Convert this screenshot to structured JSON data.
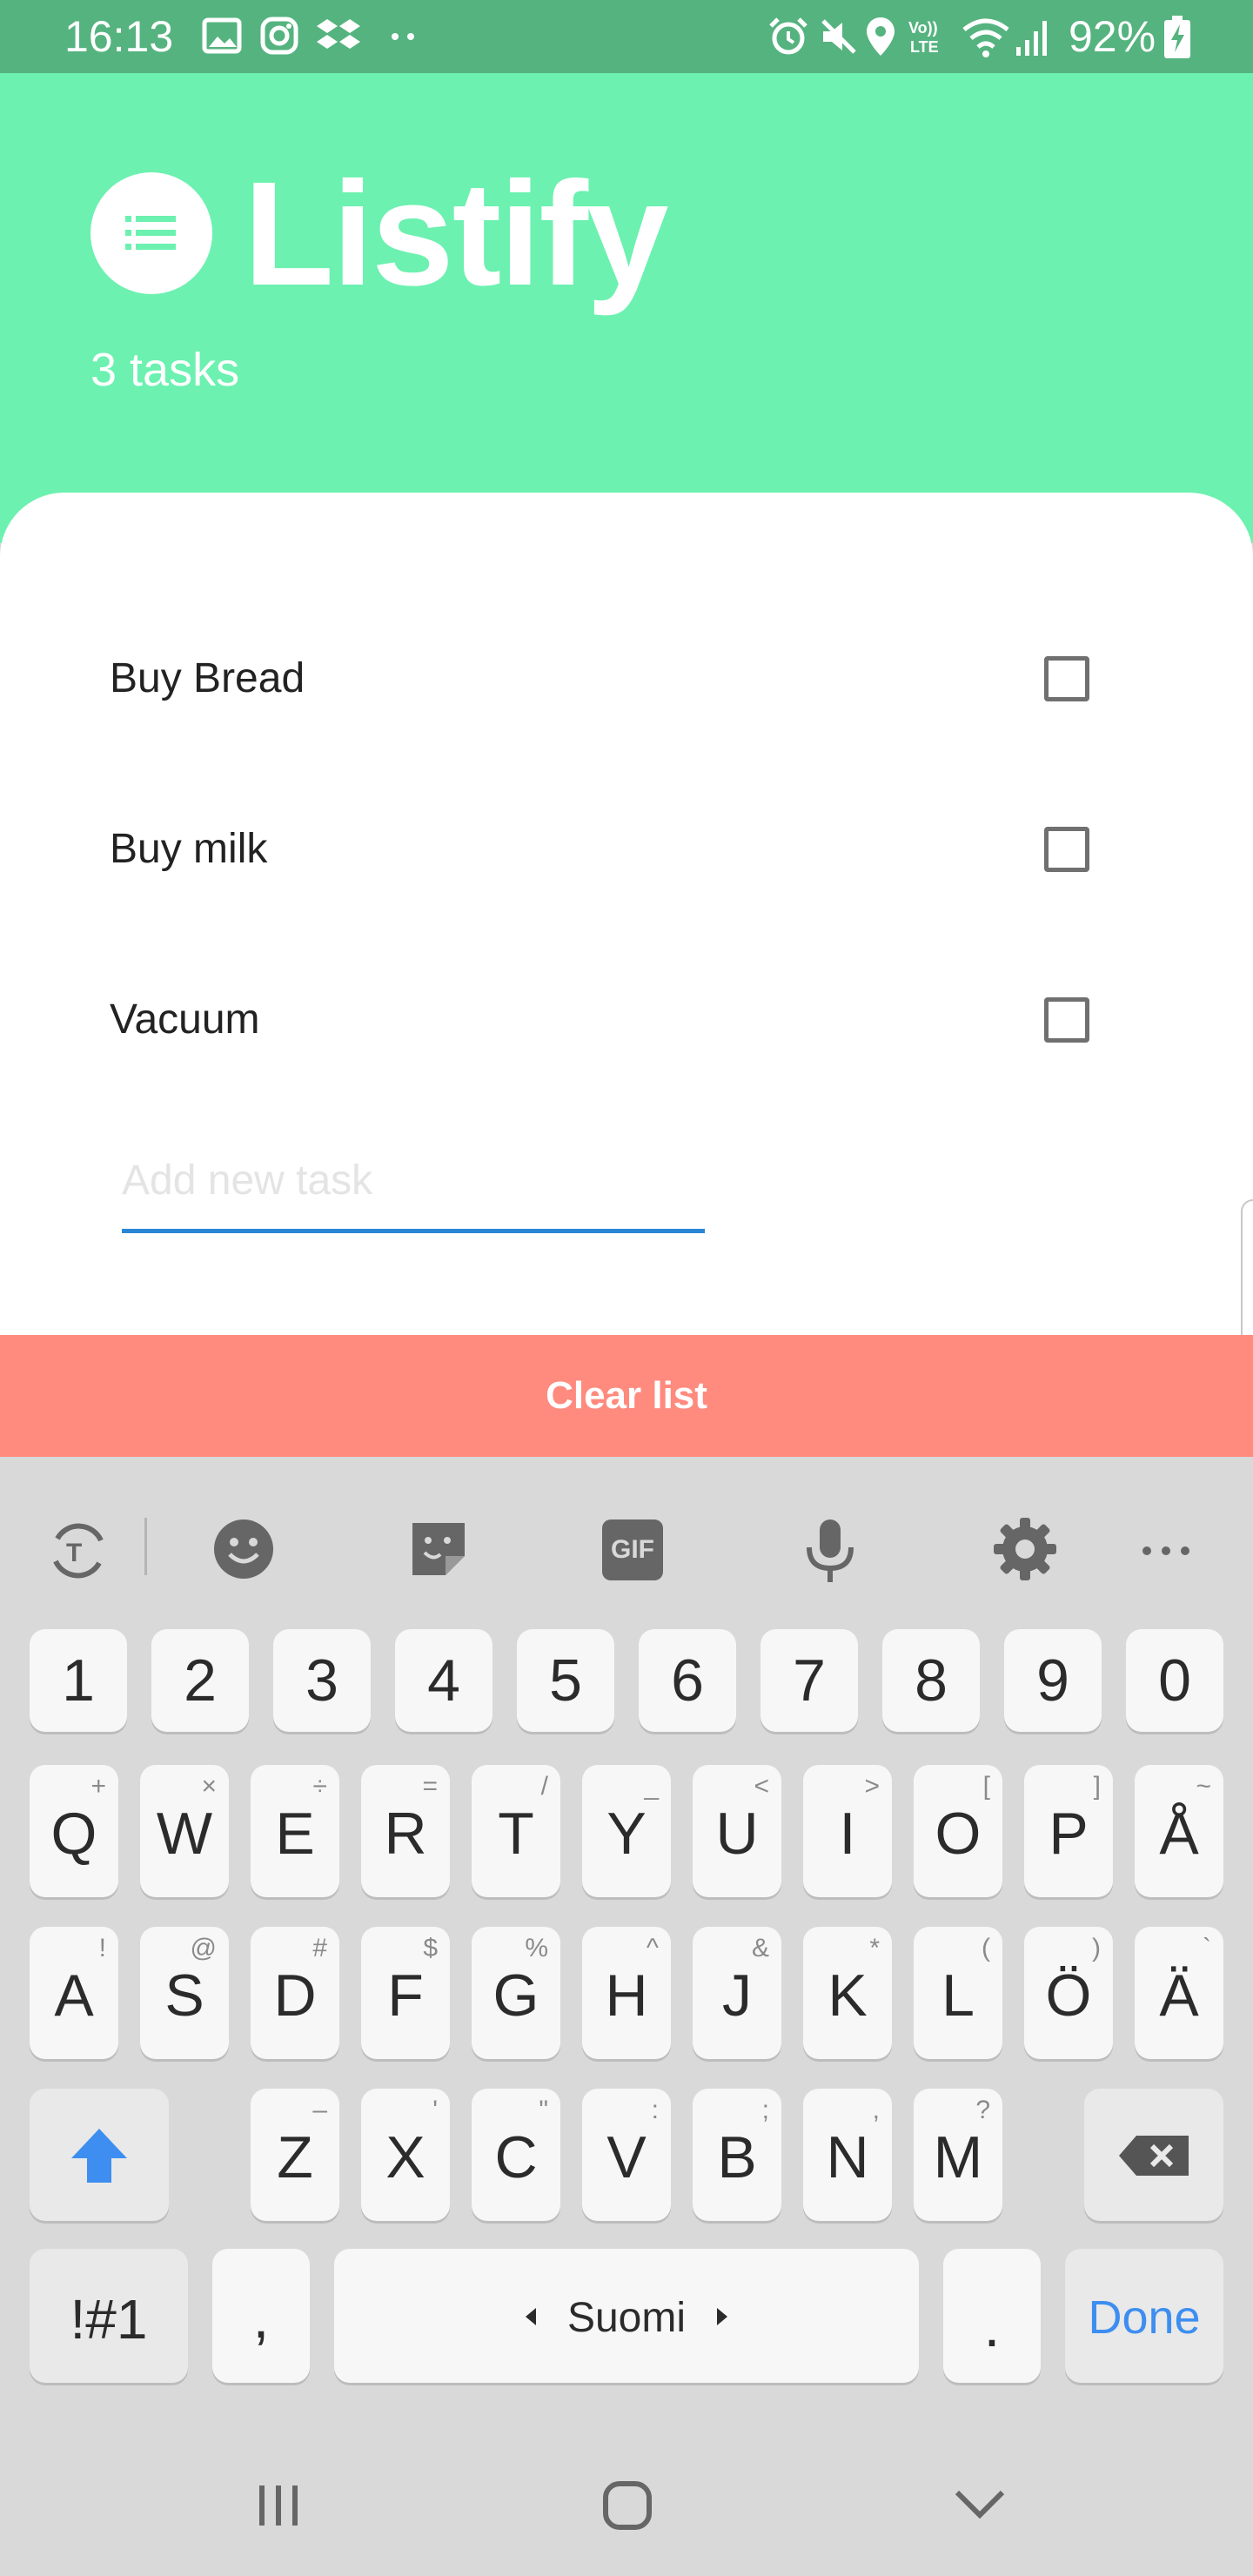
{
  "status_bar": {
    "time": "16:13",
    "battery": "92%",
    "left_icons": [
      "image-icon",
      "instagram-icon",
      "dropbox-icon",
      "more-dots-icon"
    ],
    "right_icons": [
      "alarm-icon",
      "mute-icon",
      "location-icon",
      "volte-icon",
      "wifi-icon",
      "signal-icon",
      "battery-charging-icon"
    ]
  },
  "header": {
    "app_title": "Listify",
    "task_count": "3 tasks",
    "logo_icon": "list-icon"
  },
  "tasks": [
    {
      "label": "Buy Bread",
      "checked": false
    },
    {
      "label": "Buy milk",
      "checked": false
    },
    {
      "label": "Vacuum",
      "checked": false
    }
  ],
  "new_task": {
    "placeholder": "Add new task",
    "value": ""
  },
  "clear_button": {
    "label": "Clear list"
  },
  "keyboard": {
    "toolbar_icons": [
      "text-translate-icon",
      "emoji-icon",
      "sticker-icon",
      "gif-icon",
      "microphone-icon",
      "settings-icon",
      "more-icon"
    ],
    "gif_label": "GIF",
    "number_row": [
      "1",
      "2",
      "3",
      "4",
      "5",
      "6",
      "7",
      "8",
      "9",
      "0"
    ],
    "row1": [
      {
        "main": "Q",
        "sub": "+"
      },
      {
        "main": "W",
        "sub": "×"
      },
      {
        "main": "E",
        "sub": "÷"
      },
      {
        "main": "R",
        "sub": "="
      },
      {
        "main": "T",
        "sub": "/"
      },
      {
        "main": "Y",
        "sub": "_"
      },
      {
        "main": "U",
        "sub": "<"
      },
      {
        "main": "I",
        "sub": ">"
      },
      {
        "main": "O",
        "sub": "["
      },
      {
        "main": "P",
        "sub": "]"
      },
      {
        "main": "Å",
        "sub": "~"
      }
    ],
    "row2": [
      {
        "main": "A",
        "sub": "!"
      },
      {
        "main": "S",
        "sub": "@"
      },
      {
        "main": "D",
        "sub": "#"
      },
      {
        "main": "F",
        "sub": "$"
      },
      {
        "main": "G",
        "sub": "%"
      },
      {
        "main": "H",
        "sub": "^"
      },
      {
        "main": "J",
        "sub": "&"
      },
      {
        "main": "K",
        "sub": "*"
      },
      {
        "main": "L",
        "sub": "("
      },
      {
        "main": "Ö",
        "sub": ")"
      },
      {
        "main": "Ä",
        "sub": "`"
      }
    ],
    "row3": [
      {
        "main": "Z",
        "sub": "–"
      },
      {
        "main": "X",
        "sub": "'"
      },
      {
        "main": "C",
        "sub": "\""
      },
      {
        "main": "V",
        "sub": ":"
      },
      {
        "main": "B",
        "sub": ";"
      },
      {
        "main": "N",
        "sub": ","
      },
      {
        "main": "M",
        "sub": "?"
      }
    ],
    "symbols_label": "!#1",
    "comma_label": ",",
    "space_label": "Suomi",
    "period_label": ".",
    "done_label": "Done",
    "accent_color": "#3d8ef0"
  },
  "nav_bar": {
    "icons": [
      "recent-apps-icon",
      "home-icon",
      "back-icon"
    ]
  },
  "colors": {
    "header": "#6cf1b0",
    "status_bar": "#55b37f",
    "clear_button": "#ff8a7e",
    "input_underline": "#2a86d4"
  }
}
